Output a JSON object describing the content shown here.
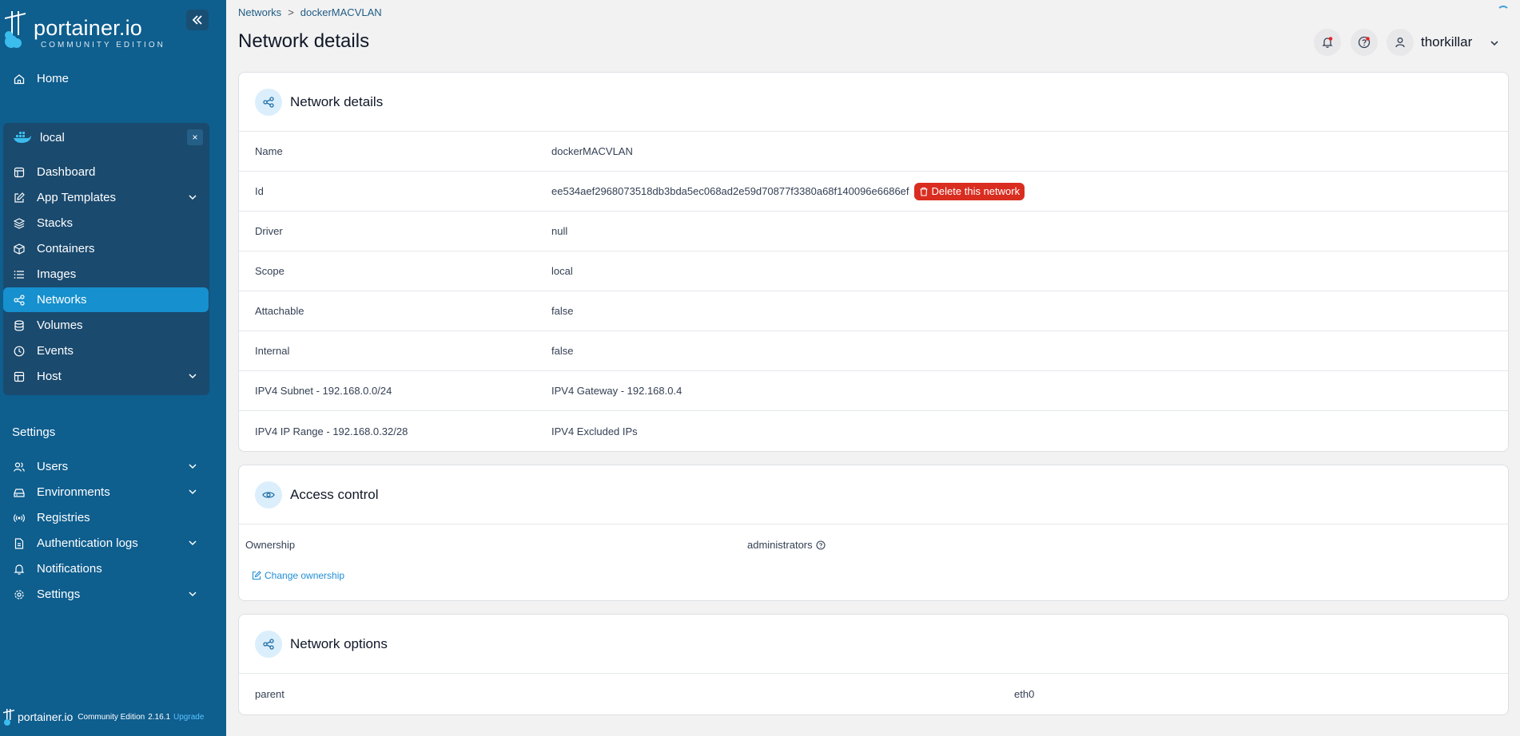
{
  "app": {
    "logo_text": "portainer.io",
    "logo_sub": "COMMUNITY EDITION"
  },
  "sidebar": {
    "home": "Home",
    "environment": "local",
    "env_close": "×",
    "env_items": [
      {
        "label": "Dashboard",
        "icon": "dashboard-icon"
      },
      {
        "label": "App Templates",
        "icon": "edit-icon",
        "expandable": true
      },
      {
        "label": "Stacks",
        "icon": "layers-icon"
      },
      {
        "label": "Containers",
        "icon": "box-icon"
      },
      {
        "label": "Images",
        "icon": "list-icon"
      },
      {
        "label": "Networks",
        "icon": "share-icon",
        "active": true
      },
      {
        "label": "Volumes",
        "icon": "database-icon"
      },
      {
        "label": "Events",
        "icon": "clock-icon"
      },
      {
        "label": "Host",
        "icon": "host-icon",
        "expandable": true
      }
    ],
    "settings_label": "Settings",
    "settings_items": [
      {
        "label": "Users",
        "icon": "users-icon",
        "expandable": true
      },
      {
        "label": "Environments",
        "icon": "hdd-icon",
        "expandable": true
      },
      {
        "label": "Registries",
        "icon": "radio-icon"
      },
      {
        "label": "Authentication logs",
        "icon": "file-icon",
        "expandable": true
      },
      {
        "label": "Notifications",
        "icon": "bell-icon"
      },
      {
        "label": "Settings",
        "icon": "gear-icon",
        "expandable": true
      }
    ],
    "footer": {
      "brand": "portainer.io",
      "edition": "Community Edition",
      "version": "2.16.1",
      "upgrade": "Upgrade"
    }
  },
  "header": {
    "breadcrumb": [
      "Networks",
      "dockerMACVLAN"
    ],
    "breadcrumb_sep": ">",
    "title": "Network details",
    "user": "thorkillar"
  },
  "network_details": {
    "title": "Network details",
    "rows": [
      {
        "key": "Name",
        "value": "dockerMACVLAN"
      },
      {
        "key": "Id",
        "value": "ee534aef2968073518db3bda5ec068ad2e59d70877f3380a68f140096e6686ef"
      },
      {
        "key": "Driver",
        "value": "null"
      },
      {
        "key": "Scope",
        "value": "local"
      },
      {
        "key": "Attachable",
        "value": "false"
      },
      {
        "key": "Internal",
        "value": "false"
      },
      {
        "key": "IPV4 Subnet - 192.168.0.0/24",
        "value": "IPV4 Gateway - 192.168.0.4"
      },
      {
        "key": "IPV4 IP Range - 192.168.0.32/28",
        "value": "IPV4 Excluded IPs"
      }
    ],
    "delete_label": "Delete this network"
  },
  "access_control": {
    "title": "Access control",
    "ownership_label": "Ownership",
    "ownership_value": "administrators",
    "change_ownership": "Change ownership"
  },
  "network_options": {
    "title": "Network options",
    "rows": [
      {
        "key": "parent",
        "value": "eth0"
      }
    ]
  },
  "colors": {
    "sidebar_bg": "#0e5e8e",
    "active_item": "#1690ce",
    "danger": "#d92d20",
    "link": "#1f8ed6"
  }
}
